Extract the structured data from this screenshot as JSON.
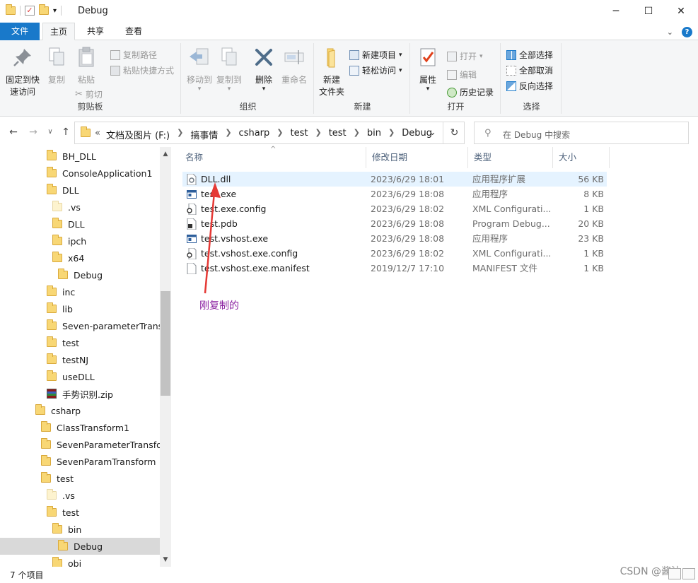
{
  "window": {
    "title": "Debug",
    "minimize": "─",
    "maximize": "☐",
    "close": "✕"
  },
  "ribbon_tabs": [
    {
      "label": "文件"
    },
    {
      "label": "主页"
    },
    {
      "label": "共享"
    },
    {
      "label": "查看"
    }
  ],
  "ribbon": {
    "clipboard": {
      "pin": "固定到快速访问",
      "pin_line1": "固定到快",
      "pin_line2": "速访问",
      "copy": "复制",
      "paste": "粘贴",
      "copy_path": "复制路径",
      "paste_shortcut": "粘贴快捷方式",
      "cut": "剪切",
      "label": "剪贴板"
    },
    "organize": {
      "move_to": "移动到",
      "copy_to": "复制到",
      "delete": "删除",
      "rename": "重命名",
      "label": "组织"
    },
    "new": {
      "new_folder_line1": "新建",
      "new_folder_line2": "文件夹",
      "new_item": "新建项目",
      "easy_access": "轻松访问",
      "label": "新建"
    },
    "open": {
      "properties": "属性",
      "open": "打开",
      "edit": "编辑",
      "history": "历史记录",
      "label": "打开"
    },
    "select": {
      "select_all": "全部选择",
      "select_none": "全部取消",
      "invert": "反向选择",
      "label": "选择"
    }
  },
  "nav": {
    "back": "←",
    "forward": "→",
    "recent": "∨",
    "up": "↑",
    "breadcrumb_prefix": "«",
    "breadcrumbs": [
      "文档及图片 (F:)",
      "搞事情",
      "csharp",
      "test",
      "test",
      "bin",
      "Debug"
    ],
    "search_placeholder": "在 Debug 中搜索"
  },
  "tree": [
    {
      "label": "BH_DLL",
      "indent": 0,
      "kind": "folder"
    },
    {
      "label": "ConsoleApplication1",
      "indent": 0,
      "kind": "folder"
    },
    {
      "label": "DLL",
      "indent": 0,
      "kind": "folder"
    },
    {
      "label": ".vs",
      "indent": 1,
      "kind": "folder-pale"
    },
    {
      "label": "DLL",
      "indent": 1,
      "kind": "folder"
    },
    {
      "label": "ipch",
      "indent": 1,
      "kind": "folder"
    },
    {
      "label": "x64",
      "indent": 1,
      "kind": "folder"
    },
    {
      "label": "Debug",
      "indent": 2,
      "kind": "folder"
    },
    {
      "label": "inc",
      "indent": 0,
      "kind": "folder"
    },
    {
      "label": "lib",
      "indent": 0,
      "kind": "folder"
    },
    {
      "label": "Seven-parameterTransfo",
      "indent": 0,
      "kind": "folder"
    },
    {
      "label": "test",
      "indent": 0,
      "kind": "folder"
    },
    {
      "label": "testNJ",
      "indent": 0,
      "kind": "folder"
    },
    {
      "label": "useDLL",
      "indent": 0,
      "kind": "folder"
    },
    {
      "label": "手势识别.zip",
      "indent": 0,
      "kind": "zip"
    },
    {
      "label": "csharp",
      "indent": -2,
      "kind": "folder"
    },
    {
      "label": "ClassTransform1",
      "indent": -1,
      "kind": "folder"
    },
    {
      "label": "SevenParameterTransforr",
      "indent": -1,
      "kind": "folder"
    },
    {
      "label": "SevenParamTransform",
      "indent": -1,
      "kind": "folder"
    },
    {
      "label": "test",
      "indent": -1,
      "kind": "folder"
    },
    {
      "label": ".vs",
      "indent": 0,
      "kind": "folder-pale"
    },
    {
      "label": "test",
      "indent": 0,
      "kind": "folder"
    },
    {
      "label": "bin",
      "indent": 1,
      "kind": "folder"
    },
    {
      "label": "Debug",
      "indent": 2,
      "kind": "folder",
      "selected": true
    },
    {
      "label": "obj",
      "indent": 1,
      "kind": "folder"
    }
  ],
  "columns": {
    "name": "名称",
    "date": "修改日期",
    "type": "类型",
    "size": "大小"
  },
  "files": [
    {
      "name": "DLL.dll",
      "date": "2023/6/29 18:01",
      "type": "应用程序扩展",
      "size": "56 KB",
      "icon": "dll-icon",
      "highlight": true
    },
    {
      "name": "test.exe",
      "date": "2023/6/29 18:08",
      "type": "应用程序",
      "size": "8 KB",
      "icon": "exe-icon"
    },
    {
      "name": "test.exe.config",
      "date": "2023/6/29 18:02",
      "type": "XML Configurati...",
      "size": "1 KB",
      "icon": "config-icon"
    },
    {
      "name": "test.pdb",
      "date": "2023/6/29 18:08",
      "type": "Program Debug...",
      "size": "20 KB",
      "icon": "pdb-icon"
    },
    {
      "name": "test.vshost.exe",
      "date": "2023/6/29 18:08",
      "type": "应用程序",
      "size": "23 KB",
      "icon": "exe-icon"
    },
    {
      "name": "test.vshost.exe.config",
      "date": "2023/6/29 18:02",
      "type": "XML Configurati...",
      "size": "1 KB",
      "icon": "config-icon"
    },
    {
      "name": "test.vshost.exe.manifest",
      "date": "2019/12/7 17:10",
      "type": "MANIFEST 文件",
      "size": "1 KB",
      "icon": "file-icon"
    }
  ],
  "annotation": "刚复制的",
  "status": {
    "count": "7 个项目",
    "watermark": "CSDN @酱油"
  },
  "colors": {
    "accent": "#1979ca",
    "arrow": "#e53935",
    "annotation": "#8a1fa0",
    "row_highlight": "#e5f3ff"
  }
}
